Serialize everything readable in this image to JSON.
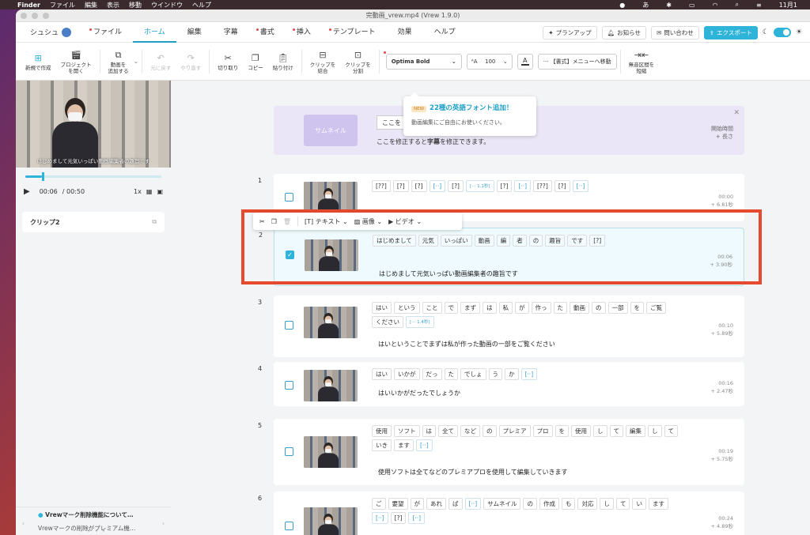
{
  "macos": {
    "apple": "",
    "finder": "Finder",
    "menus": [
      "ファイル",
      "編集",
      "表示",
      "移動",
      "ウインドウ",
      "ヘルプ"
    ],
    "status_right": "11月1"
  },
  "window": {
    "title": "完動画_vrew.mp4 (Vrew 1.9.0)"
  },
  "menubar": {
    "user": "シュシュ",
    "tabs": [
      {
        "label": "ファイル",
        "dot": true
      },
      {
        "label": "ホーム",
        "active": true
      },
      {
        "label": "編集"
      },
      {
        "label": "字幕"
      },
      {
        "label": "書式",
        "dot": true
      },
      {
        "label": "挿入",
        "dot": true
      },
      {
        "label": "テンプレート",
        "dot": true
      },
      {
        "label": "効果"
      },
      {
        "label": "ヘルプ"
      }
    ],
    "plan_up": "プランアップ",
    "notice": "お知らせ",
    "contact": "問い合わせ",
    "export": "エクスポート"
  },
  "toolbar": {
    "new": "新規で作成",
    "open": "プロジェクト\nを開く",
    "add_video": "動画を\n追加する",
    "undo": "元に戻す",
    "redo": "やり直す",
    "cut": "切り取り",
    "copy": "コピー",
    "paste": "貼り付け",
    "merge": "クリップを\n結合",
    "split": "クリップを\n分割",
    "font": "Optima Bold",
    "size": "100",
    "color_label": "A",
    "format_menu": "【書式】メニューへ移動",
    "silence": "無音区間を\n短縮"
  },
  "font_tooltip": {
    "badge": "NEW",
    "title": "22種の英語フォント追加！",
    "desc": "動画編集にご自由にお使いください。"
  },
  "player": {
    "subtitle": "はじめまして元気いっぱい動画編集者の趣旨です",
    "current": "00:06",
    "total": "/ 00:50",
    "progress": 0.12,
    "speed": "1x",
    "clip_name": "クリップ2"
  },
  "notice_bar": {
    "title": "Vrewマーク削除機能について…",
    "body": "Vrewマークの削除がプレミアム機…"
  },
  "thumbnail_card": {
    "button": "サムネイル",
    "input": "ここを",
    "hint_pre": "ここを修正すると",
    "hint_bold": "字幕",
    "hint_post": "を修正できます。",
    "start_label": "開始時間",
    "len_label": "+ 長さ"
  },
  "context_menu": {
    "text": "テキスト",
    "image": "画像",
    "video": "ビデオ"
  },
  "clips": [
    {
      "num": "1",
      "words": [
        "[??]",
        "[?]",
        "[?]",
        "[··]",
        "[?]",
        "[··· 1.1秒]",
        "[?]",
        "[··]",
        "[??]",
        "[?]",
        "[··]"
      ],
      "subtitle": "",
      "time": "00:00",
      "dur": "+ 6.81秒",
      "checked": false
    },
    {
      "num": "2",
      "words": [
        "はじめまして",
        "元気",
        "いっぱい",
        "動画",
        "編",
        "者",
        "の",
        "趣旨",
        "です",
        "[?]"
      ],
      "subtitle": "はじめまして元気いっぱい動画編集者の趣旨です",
      "time": "00:06",
      "dur": "+ 3.90秒",
      "checked": true
    },
    {
      "num": "3",
      "words": [
        "はい",
        "という",
        "こと",
        "で",
        "まず",
        "は",
        "私",
        "が",
        "作っ",
        "た",
        "動画",
        "の",
        "一部",
        "を",
        "ご覧",
        "ください",
        "[··· 1.4秒]"
      ],
      "subtitle": "はいということでまずは私が作った動画の一部をご覧ください",
      "time": "00:10",
      "dur": "+ 5.89秒",
      "checked": false
    },
    {
      "num": "4",
      "words": [
        "はい",
        "いかが",
        "だっ",
        "た",
        "でしょ",
        "う",
        "か",
        "[··]"
      ],
      "subtitle": "はいいかがだったでしょうか",
      "time": "00:16",
      "dur": "+ 2.47秒",
      "checked": false
    },
    {
      "num": "5",
      "words": [
        "使用",
        "ソフト",
        "は",
        "全て",
        "など",
        "の",
        "プレミア",
        "プロ",
        "を",
        "使用",
        "し",
        "て",
        "編集",
        "し",
        "て",
        "いき",
        "ます",
        "[··]"
      ],
      "subtitle": "使用ソフトは全てなどのプレミアプロを使用して編集していきます",
      "time": "00:19",
      "dur": "+ 5.75秒",
      "checked": false
    },
    {
      "num": "6",
      "words": [
        "ご",
        "要望",
        "が",
        "あれ",
        "ば",
        "[··]",
        "サムネイル",
        "の",
        "作成",
        "も",
        "対応",
        "し",
        "て",
        "い",
        "ます",
        "[··]",
        "[?]",
        "[··]"
      ],
      "subtitle": "",
      "time": "00:24",
      "dur": "+ 4.89秒",
      "checked": false
    }
  ]
}
